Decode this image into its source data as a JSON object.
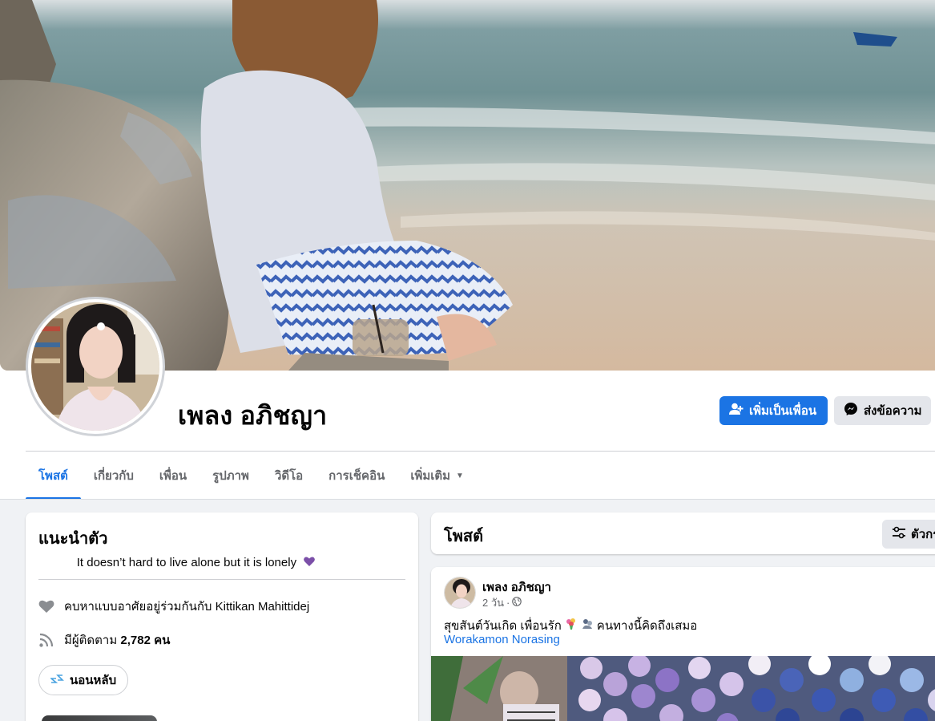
{
  "profile": {
    "name": "เพลง อภิชญา"
  },
  "actions": {
    "add_friend": "เพิ่มเป็นเพื่อน",
    "message": "ส่งข้อความ"
  },
  "tabs": [
    {
      "label": "โพสต์",
      "active": true
    },
    {
      "label": "เกี่ยวกับ",
      "active": false
    },
    {
      "label": "เพื่อน",
      "active": false
    },
    {
      "label": "รูปภาพ",
      "active": false
    },
    {
      "label": "วิดีโอ",
      "active": false
    },
    {
      "label": "การเช็คอิน",
      "active": false
    },
    {
      "label": "เพิ่มเติม",
      "active": false
    }
  ],
  "intro": {
    "title": "แนะนำตัว",
    "bio": "It doesn’t hard to live alone but it is lonely",
    "relationship_prefix": "คบหาแบบอาศัยอยู่ร่วมกันกับ",
    "relationship_name": "Kittikan Mahittidej",
    "followers_prefix": "มีผู้ติดตาม",
    "followers_count": "2,782 คน",
    "status_pill": "นอนหลับ"
  },
  "posts_section": {
    "title": "โพสต์",
    "filter_label": "ตัวกร"
  },
  "post": {
    "author": "เพลง อภิชญา",
    "time": "2 วัน",
    "text_part1": "สุขสันต์วันเกิด เพื่อนรัก",
    "text_part2": "คนทางนี้คิดถึงเสมอ",
    "tagged": "Worakamon Norasing"
  },
  "colors": {
    "accent": "#1b74e4",
    "secondary_button": "#e4e6eb",
    "muted_text": "#65676b"
  }
}
